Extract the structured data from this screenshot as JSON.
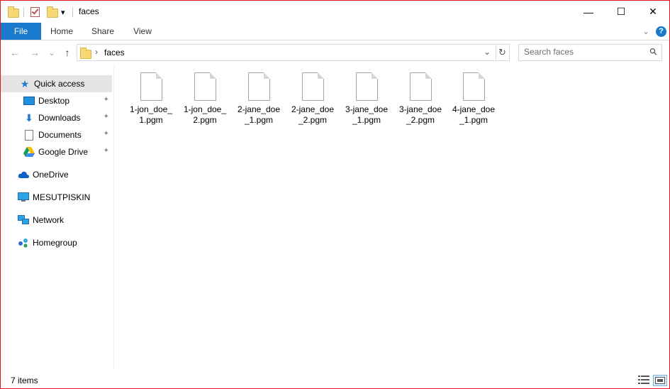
{
  "window": {
    "title": "faces",
    "accent": "#1979ca",
    "border": "#e81123"
  },
  "titlebar": {
    "minimize_glyph": "—",
    "maximize_glyph": "☐",
    "close_glyph": "✕",
    "dropdown_glyph": "▾"
  },
  "ribbon": {
    "tabs": [
      {
        "label": "File",
        "active": true
      },
      {
        "label": "Home"
      },
      {
        "label": "Share"
      },
      {
        "label": "View"
      }
    ],
    "expand_glyph": "⌄",
    "help_glyph": "?"
  },
  "nav": {
    "back_glyph": "←",
    "forward_glyph": "→",
    "recent_glyph": "⌄",
    "up_glyph": "↑"
  },
  "address": {
    "separator": "›",
    "location": "faces",
    "dropdown_glyph": "⌄",
    "refresh_glyph": "↻"
  },
  "search": {
    "placeholder": "Search faces",
    "icon_glyph": "⚲"
  },
  "sidebar": {
    "items": [
      {
        "label": "Quick access",
        "icon": "star-icon",
        "selected": true
      },
      {
        "label": "Desktop",
        "icon": "desktop-icon",
        "pinned": true
      },
      {
        "label": "Downloads",
        "icon": "download-icon",
        "pinned": true
      },
      {
        "label": "Documents",
        "icon": "documents-icon",
        "pinned": true
      },
      {
        "label": "Google Drive",
        "icon": "google-drive-icon",
        "pinned": true
      },
      {
        "label": "OneDrive",
        "icon": "onedrive-icon"
      },
      {
        "label": "MESUTPISKIN",
        "icon": "computer-icon"
      },
      {
        "label": "Network",
        "icon": "network-icon"
      },
      {
        "label": "Homegroup",
        "icon": "homegroup-icon"
      }
    ],
    "pin_glyph": "📌"
  },
  "files": [
    {
      "line1": "1-jon_doe_",
      "line2": "1.pgm"
    },
    {
      "line1": "1-jon_doe_",
      "line2": "2.pgm"
    },
    {
      "line1": "2-jane_doe",
      "line2": "_1.pgm"
    },
    {
      "line1": "2-jane_doe",
      "line2": "_2.pgm"
    },
    {
      "line1": "3-jane_doe",
      "line2": "_1.pgm"
    },
    {
      "line1": "3-jane_doe",
      "line2": "_2.pgm"
    },
    {
      "line1": "4-jane_doe",
      "line2": "_1.pgm"
    }
  ],
  "status": {
    "item_count": "7 items"
  }
}
